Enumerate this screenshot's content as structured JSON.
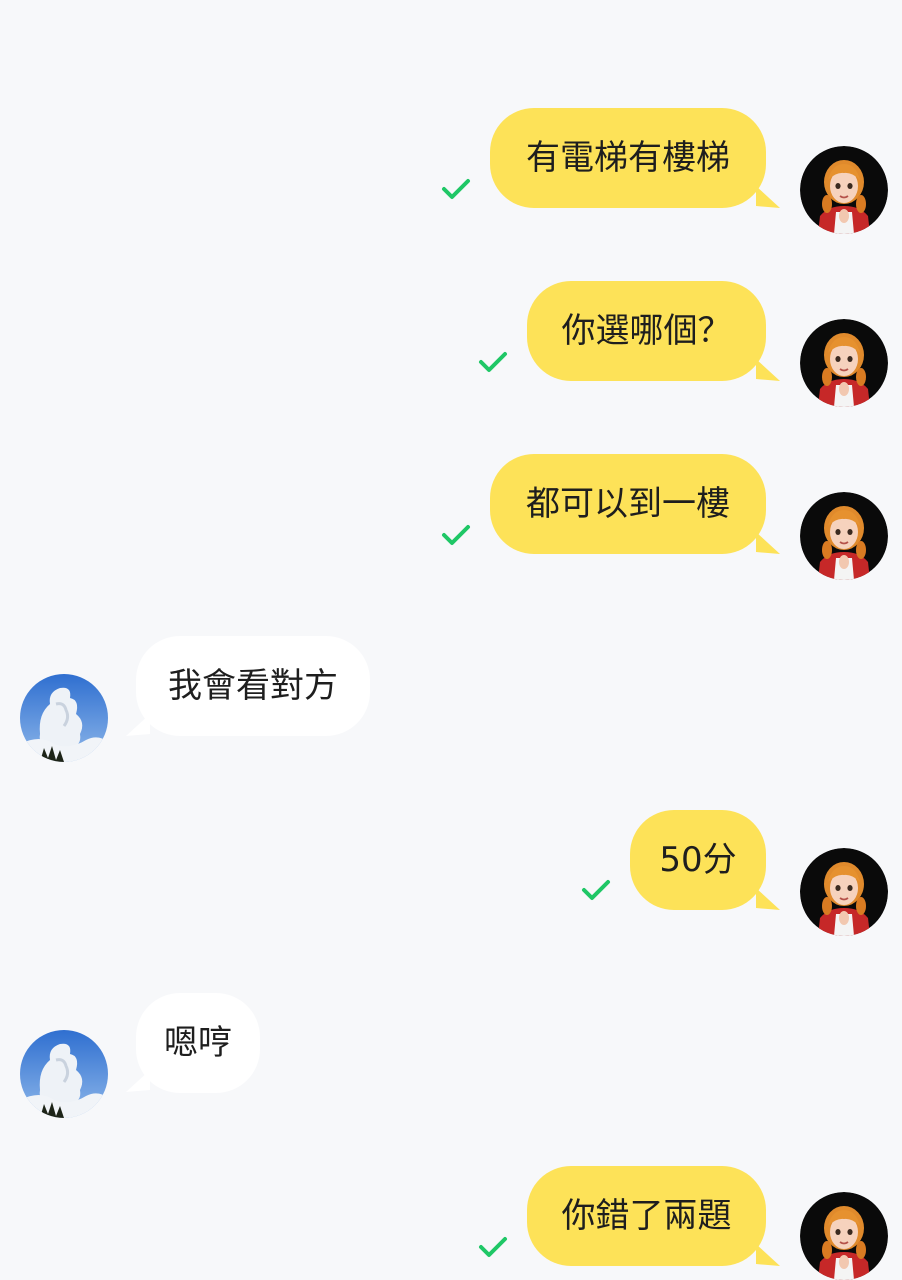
{
  "messages": [
    {
      "side": "out",
      "text": "有電梯有樓梯",
      "read_icon": "check-icon"
    },
    {
      "side": "out",
      "text": "你選哪個？",
      "read_icon": "check-icon"
    },
    {
      "side": "out",
      "text": "都可以到一樓",
      "read_icon": "check-icon"
    },
    {
      "side": "in",
      "text": "我會看對方"
    },
    {
      "side": "out",
      "text": "50分",
      "read_icon": "check-icon"
    },
    {
      "side": "in",
      "text": "嗯哼"
    },
    {
      "side": "out",
      "text": "你錯了兩題",
      "read_icon": "check-icon"
    }
  ],
  "colors": {
    "background": "#f7f8fa",
    "outgoing_bubble": "#fde258",
    "incoming_bubble": "#ffffff",
    "check": "#1fc766",
    "text": "#1e1e1e"
  },
  "avatars": {
    "self": "girl-avatar",
    "contact": "sky-cloud-avatar"
  }
}
